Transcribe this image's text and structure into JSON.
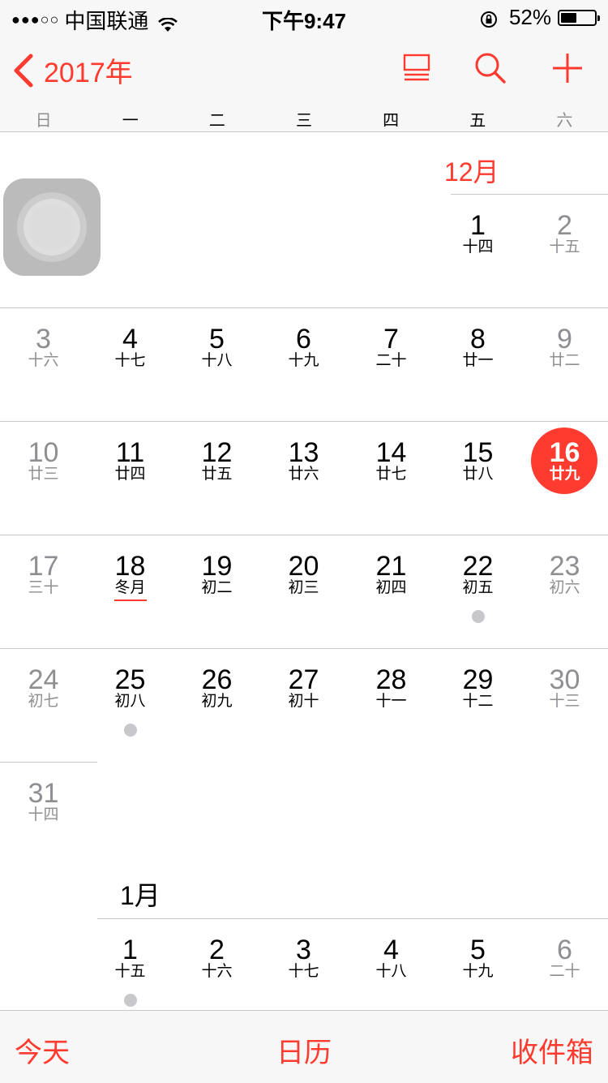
{
  "status_bar": {
    "signal": "●●●○○",
    "carrier": "中国联通",
    "time": "下午9:47",
    "battery_text": "52%",
    "battery_level_percent": 52
  },
  "nav": {
    "back_label": "2017年",
    "accent_color": "#ff3b30",
    "icons": [
      "list-view-icon",
      "search-icon",
      "plus-icon"
    ]
  },
  "weekdays": [
    "日",
    "一",
    "二",
    "三",
    "四",
    "五",
    "六"
  ],
  "months": {
    "december_label": "12月",
    "january_label": "1月"
  },
  "december_weeks": [
    [
      {
        "col": 5,
        "num": "1",
        "lunar": "十四"
      },
      {
        "col": 6,
        "num": "2",
        "lunar": "十五"
      }
    ],
    [
      {
        "col": 0,
        "num": "3",
        "lunar": "十六"
      },
      {
        "col": 1,
        "num": "4",
        "lunar": "十七"
      },
      {
        "col": 2,
        "num": "5",
        "lunar": "十八"
      },
      {
        "col": 3,
        "num": "6",
        "lunar": "十九"
      },
      {
        "col": 4,
        "num": "7",
        "lunar": "二十"
      },
      {
        "col": 5,
        "num": "8",
        "lunar": "廿一"
      },
      {
        "col": 6,
        "num": "9",
        "lunar": "廿二"
      }
    ],
    [
      {
        "col": 0,
        "num": "10",
        "lunar": "廿三"
      },
      {
        "col": 1,
        "num": "11",
        "lunar": "廿四"
      },
      {
        "col": 2,
        "num": "12",
        "lunar": "廿五"
      },
      {
        "col": 3,
        "num": "13",
        "lunar": "廿六"
      },
      {
        "col": 4,
        "num": "14",
        "lunar": "廿七"
      },
      {
        "col": 5,
        "num": "15",
        "lunar": "廿八"
      },
      {
        "col": 6,
        "num": "16",
        "lunar": "廿九",
        "today": true
      }
    ],
    [
      {
        "col": 0,
        "num": "17",
        "lunar": "三十"
      },
      {
        "col": 1,
        "num": "18",
        "lunar": "冬月",
        "term": true
      },
      {
        "col": 2,
        "num": "19",
        "lunar": "初二"
      },
      {
        "col": 3,
        "num": "20",
        "lunar": "初三"
      },
      {
        "col": 4,
        "num": "21",
        "lunar": "初四"
      },
      {
        "col": 5,
        "num": "22",
        "lunar": "初五",
        "event": true
      },
      {
        "col": 6,
        "num": "23",
        "lunar": "初六"
      }
    ],
    [
      {
        "col": 0,
        "num": "24",
        "lunar": "初七"
      },
      {
        "col": 1,
        "num": "25",
        "lunar": "初八",
        "event": true
      },
      {
        "col": 2,
        "num": "26",
        "lunar": "初九"
      },
      {
        "col": 3,
        "num": "27",
        "lunar": "初十"
      },
      {
        "col": 4,
        "num": "28",
        "lunar": "十一"
      },
      {
        "col": 5,
        "num": "29",
        "lunar": "十二"
      },
      {
        "col": 6,
        "num": "30",
        "lunar": "十三"
      }
    ],
    [
      {
        "col": 0,
        "num": "31",
        "lunar": "十四"
      }
    ]
  ],
  "january_weeks": [
    [
      {
        "col": 1,
        "num": "1",
        "lunar": "十五",
        "event": true
      },
      {
        "col": 2,
        "num": "2",
        "lunar": "十六"
      },
      {
        "col": 3,
        "num": "3",
        "lunar": "十七"
      },
      {
        "col": 4,
        "num": "4",
        "lunar": "十八"
      },
      {
        "col": 5,
        "num": "5",
        "lunar": "十九"
      },
      {
        "col": 6,
        "num": "6",
        "lunar": "二十"
      }
    ]
  ],
  "tabbar": {
    "today": "今天",
    "calendars": "日历",
    "inbox": "收件箱"
  }
}
